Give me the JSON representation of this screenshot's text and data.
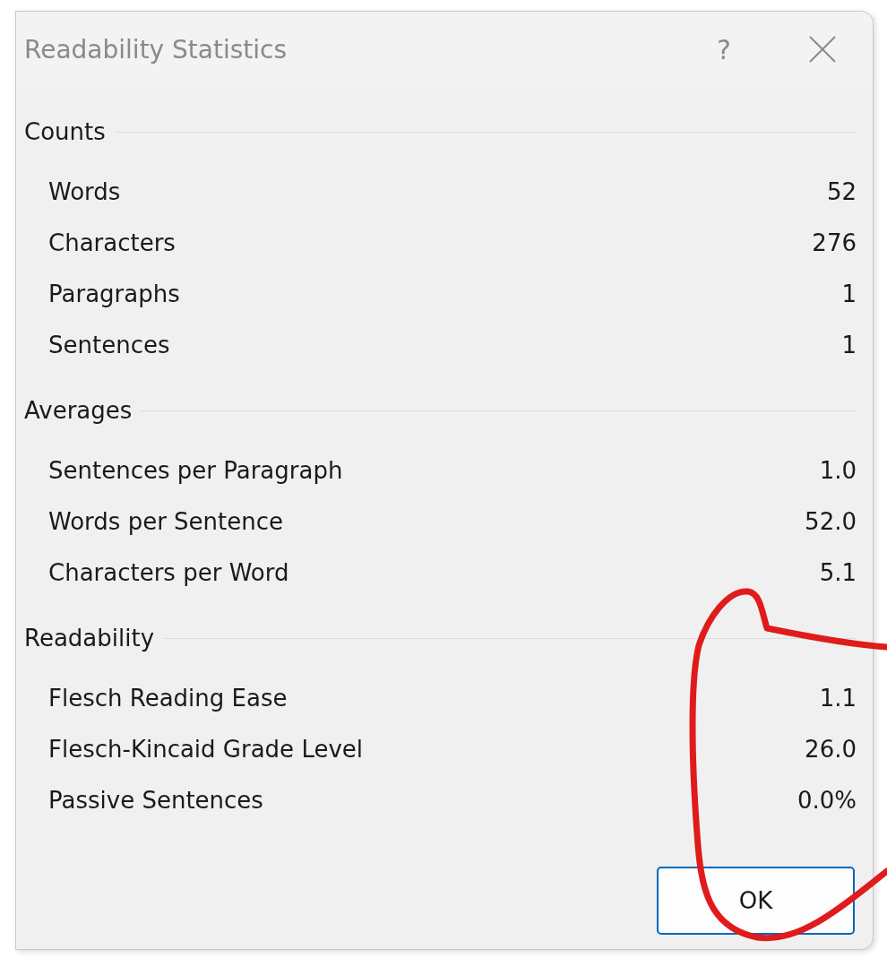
{
  "window": {
    "title": "Readability Statistics",
    "help_button": "?"
  },
  "sections": [
    {
      "heading": "Counts",
      "rows": [
        {
          "label": "Words",
          "value": "52"
        },
        {
          "label": "Characters",
          "value": "276"
        },
        {
          "label": "Paragraphs",
          "value": "1"
        },
        {
          "label": "Sentences",
          "value": "1"
        }
      ]
    },
    {
      "heading": "Averages",
      "rows": [
        {
          "label": "Sentences per Paragraph",
          "value": "1.0"
        },
        {
          "label": "Words per Sentence",
          "value": "52.0"
        },
        {
          "label": "Characters per Word",
          "value": "5.1"
        }
      ]
    },
    {
      "heading": "Readability",
      "rows": [
        {
          "label": "Flesch Reading Ease",
          "value": "1.1"
        },
        {
          "label": "Flesch-Kincaid Grade Level",
          "value": "26.0"
        },
        {
          "label": "Passive Sentences",
          "value": "0.0%"
        }
      ]
    }
  ],
  "buttons": [
    "OK"
  ]
}
